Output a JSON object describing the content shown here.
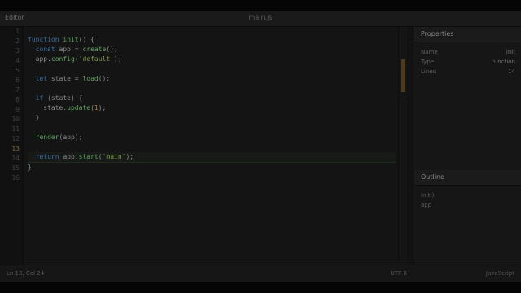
{
  "window": {
    "app_title": "Editor",
    "file_title": "main.js"
  },
  "gutter": {
    "lines": [
      "1",
      "2",
      "3",
      "4",
      "5",
      "6",
      "7",
      "8",
      "9",
      "10",
      "11",
      "12",
      "13",
      "14",
      "15",
      "16"
    ],
    "active_line_index": 12
  },
  "code": {
    "lines": [
      [
        {
          "t": "kw",
          "v": "function"
        },
        {
          "t": "id",
          "v": " "
        },
        {
          "t": "fn",
          "v": "init"
        },
        {
          "t": "id",
          "v": "() {"
        }
      ],
      [
        {
          "t": "id",
          "v": "  "
        },
        {
          "t": "kw",
          "v": "const"
        },
        {
          "t": "id",
          "v": " app = "
        },
        {
          "t": "fn",
          "v": "create"
        },
        {
          "t": "id",
          "v": "();"
        }
      ],
      [
        {
          "t": "id",
          "v": "  app."
        },
        {
          "t": "fn",
          "v": "config"
        },
        {
          "t": "id",
          "v": "("
        },
        {
          "t": "str",
          "v": "'default'"
        },
        {
          "t": "id",
          "v": ");"
        }
      ],
      [
        {
          "t": "id",
          "v": ""
        }
      ],
      [
        {
          "t": "id",
          "v": "  "
        },
        {
          "t": "kw",
          "v": "let"
        },
        {
          "t": "id",
          "v": " state = "
        },
        {
          "t": "fn",
          "v": "load"
        },
        {
          "t": "id",
          "v": "();"
        }
      ],
      [
        {
          "t": "id",
          "v": ""
        }
      ],
      [
        {
          "t": "id",
          "v": "  "
        },
        {
          "t": "kw",
          "v": "if"
        },
        {
          "t": "id",
          "v": " (state) {"
        }
      ],
      [
        {
          "t": "id",
          "v": "    state."
        },
        {
          "t": "fn",
          "v": "update"
        },
        {
          "t": "id",
          "v": "("
        },
        {
          "t": "num",
          "v": "1"
        },
        {
          "t": "id",
          "v": ");"
        }
      ],
      [
        {
          "t": "id",
          "v": "  }"
        }
      ],
      [
        {
          "t": "id",
          "v": ""
        }
      ],
      [
        {
          "t": "id",
          "v": "  "
        },
        {
          "t": "fn",
          "v": "render"
        },
        {
          "t": "id",
          "v": "(app);"
        }
      ],
      [
        {
          "t": "id",
          "v": ""
        }
      ],
      [
        {
          "t": "id",
          "v": "  "
        },
        {
          "t": "kw",
          "v": "return"
        },
        {
          "t": "id",
          "v": " app."
        },
        {
          "t": "fn",
          "v": "start"
        },
        {
          "t": "id",
          "v": "("
        },
        {
          "t": "str",
          "v": "'main'"
        },
        {
          "t": "id",
          "v": ");"
        }
      ],
      [
        {
          "t": "id",
          "v": "}"
        }
      ]
    ]
  },
  "sidepanel": {
    "header": "Properties",
    "rows": [
      {
        "label": "Name",
        "value": "init"
      },
      {
        "label": "Type",
        "value": "function"
      },
      {
        "label": "Lines",
        "value": "14"
      }
    ],
    "section_header": "Outline",
    "section_rows": [
      {
        "label": "init()",
        "value": ""
      },
      {
        "label": "app",
        "value": ""
      }
    ]
  },
  "statusbar": {
    "left": "Ln 13, Col 24",
    "right": "UTF-8",
    "far": "JavaScript"
  },
  "colors": {
    "background": "#121212",
    "keyword": "#3a6ea5",
    "function": "#5fa35f",
    "string": "#7a9a4a",
    "accent": "#4a3a1e"
  }
}
